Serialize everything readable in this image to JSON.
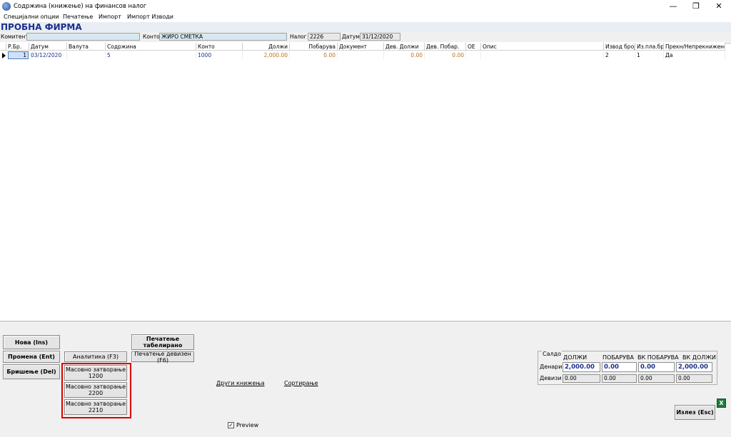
{
  "window": {
    "title": "Содржина (книжење) на финансов налог",
    "min": "—",
    "restore": "❐",
    "close": "✕"
  },
  "menu": [
    "Специјални опции",
    "Печатење",
    "Импорт",
    "Импорт Изводи"
  ],
  "firm": "ПРОБНА ФИРМА",
  "info": {
    "komitent_label": "Комитент",
    "komitent_value": "",
    "konto_label": "Конто",
    "konto_value": "ЖИРО СМЕТКА",
    "nalog_label": "Налог",
    "nalog_value": "2226",
    "datum_label": "Датум",
    "datum_value": "31/12/2020"
  },
  "grid": {
    "columns": [
      "Р.Бр.",
      "Датум",
      "Валута",
      "Содржина",
      "Конто",
      "Должи",
      "Побарува",
      "Документ",
      "Дев. Должи",
      "Дев. Побар.",
      "ОЕ",
      "Опис",
      "Извод број",
      "Из.пла.бр.",
      "Прекн/Непрекнижено"
    ],
    "rows": [
      {
        "rbr": "1",
        "datum": "03/12/2020",
        "valuta": "",
        "sodrzina": "5",
        "konto": "1000",
        "dolzi": "2,000.00",
        "pobaruva": "0.00",
        "dokument": "",
        "dev_dolzi": "0.00",
        "dev_pobar": "0.00",
        "oe": "",
        "opis": "",
        "izvod": "2",
        "izplbr": "1",
        "preknizeno": "Да"
      }
    ]
  },
  "buttons": {
    "nova": "Нова (Ins)",
    "promena": "Промена (Ent)",
    "brisenje": "Бришење (Del)",
    "analitika": "Аналитика (F3)",
    "pecatenje_tab_1": "Печатење",
    "pecatenje_tab_2": "табелирано",
    "pecatenje_deviz": "Печатење девизен (F6)",
    "masovno_1200_a": "Масовно затворање",
    "masovno_1200_b": "1200",
    "masovno_2200_a": "Масовно затворање",
    "masovno_2200_b": "2200",
    "masovno_2210_a": "Масовно затворање",
    "masovno_2210_b": "2210",
    "izlez": "Излез (Esc)"
  },
  "links": {
    "drugi": "Други книжења",
    "sortiranje": "Сортирање"
  },
  "preview": {
    "label": "Preview",
    "checked": "✓"
  },
  "saldo": {
    "title": "Салдо",
    "headers": [
      "ДОЛЖИ",
      "ПОБАРУВА",
      "ВК ПОБАРУВА",
      "ВК ДОЛЖИ"
    ],
    "denari_label": "Денари",
    "denari": [
      "2,000.00",
      "0.00",
      "0.00",
      "2,000.00"
    ],
    "devizi_label": "Девизи",
    "devizi": [
      "0.00",
      "0.00",
      "0.00",
      "0.00"
    ]
  },
  "colors": {
    "accent": "#1b2f8f",
    "highlight": "#e00000",
    "amount": "#c07020"
  }
}
